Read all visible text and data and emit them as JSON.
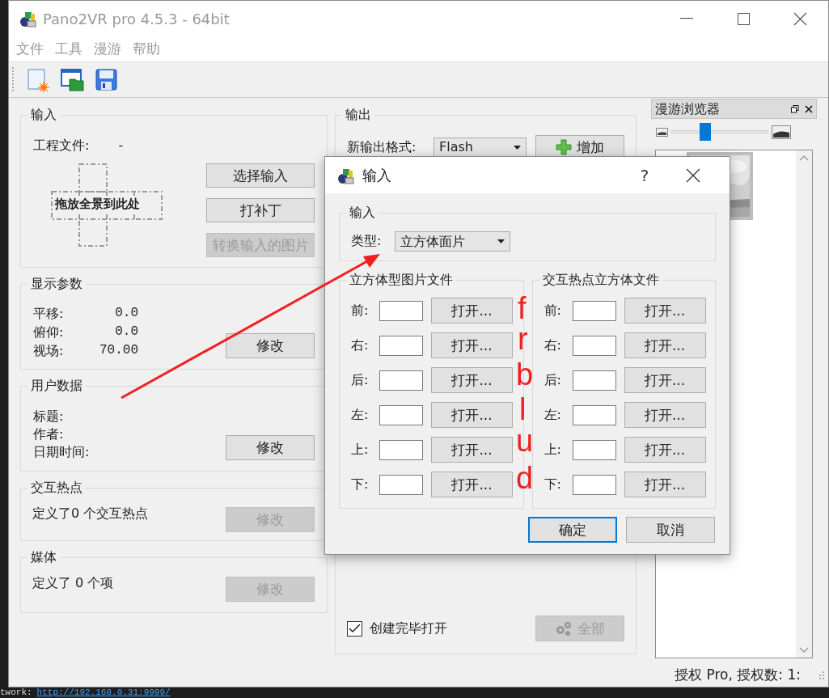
{
  "window": {
    "title": "Pano2VR pro 4.5.3 - 64bit"
  },
  "menu": [
    "文件",
    "工具",
    "漫游",
    "帮助"
  ],
  "input_panel": {
    "title": "输入",
    "project_file_label": "工程文件:",
    "project_file_value": "-",
    "drop_hint": "拖放全景到此处",
    "buttons": [
      {
        "label": "选择输入",
        "disabled": false
      },
      {
        "label": "打补丁",
        "disabled": false
      },
      {
        "label": "转换输入的图片",
        "disabled": true
      }
    ]
  },
  "display_panel": {
    "title": "显示参数",
    "fields": [
      {
        "label": "平移:",
        "value": "0.0"
      },
      {
        "label": "俯仰:",
        "value": "0.0"
      },
      {
        "label": "视场:",
        "value": "70.00"
      }
    ],
    "button": {
      "label": "修改",
      "disabled": false
    }
  },
  "user_data_panel": {
    "title": "用户数据",
    "fields": [
      "标题:",
      "作者:",
      "日期时间:"
    ],
    "button": {
      "label": "修改",
      "disabled": false
    }
  },
  "hotspot_panel": {
    "title": "交互热点",
    "summary": "定义了0 个交互热点",
    "button": {
      "label": "修改",
      "disabled": true
    }
  },
  "media_panel": {
    "title": "媒体",
    "summary": "定义了 0 个项",
    "button": {
      "label": "修改",
      "disabled": true
    }
  },
  "output_panel": {
    "title": "输出",
    "format_label": "新输出格式:",
    "format_value": "Flash",
    "add_button": "增加",
    "open_after_create": {
      "label": "创建完毕打开",
      "checked": true
    },
    "all_button": {
      "label": "全部",
      "disabled": true
    }
  },
  "tour_browser": {
    "title": "漫游浏览器",
    "zoom_slider": {
      "level": 0.33
    }
  },
  "status_bar": "授权 Pro, 授权数: 1:",
  "dialog": {
    "title": "输入",
    "help": "?",
    "input_group": {
      "title": "输入",
      "type_label": "类型:",
      "type_value": "立方体面片"
    },
    "cube_group": {
      "title": "立方体型图片文件",
      "rows": [
        {
          "label": "前:",
          "button": "打开..."
        },
        {
          "label": "右:",
          "button": "打开..."
        },
        {
          "label": "后:",
          "button": "打开..."
        },
        {
          "label": "左:",
          "button": "打开..."
        },
        {
          "label": "上:",
          "button": "打开..."
        },
        {
          "label": "下:",
          "button": "打开..."
        }
      ]
    },
    "hotspot_group": {
      "title": "交互热点立方体文件",
      "rows": [
        {
          "label": "前:",
          "button": "打开..."
        },
        {
          "label": "右:",
          "button": "打开..."
        },
        {
          "label": "后:",
          "button": "打开..."
        },
        {
          "label": "左:",
          "button": "打开..."
        },
        {
          "label": "上:",
          "button": "打开..."
        },
        {
          "label": "下:",
          "button": "打开..."
        }
      ]
    },
    "buttons": [
      {
        "label": "确定",
        "default": true
      },
      {
        "label": "取消",
        "default": false
      }
    ]
  },
  "annotations": {
    "letters": [
      "f",
      "r",
      "b",
      "l",
      "u",
      "d"
    ]
  },
  "background_text": {
    "label": "twork:",
    "link": "http://192.168.0.31:9999/"
  }
}
